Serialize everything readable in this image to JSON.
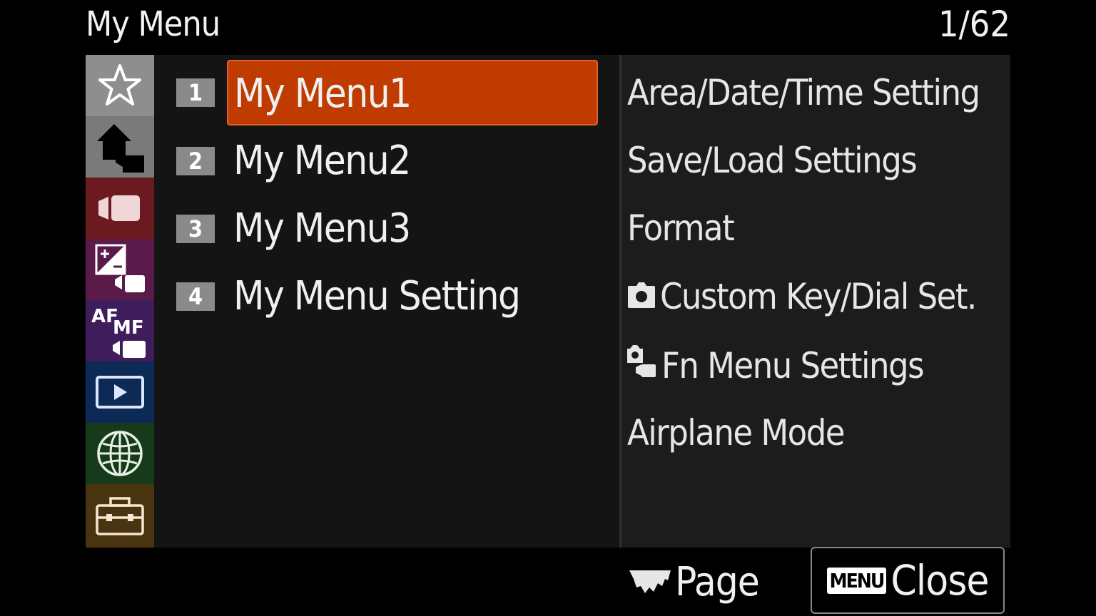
{
  "header": {
    "title": "My Menu",
    "page_indicator": "1/62"
  },
  "tabs": [
    {
      "icon": "star-icon",
      "color": "#8e8e8e"
    },
    {
      "icon": "home-icon",
      "color": "#7a7a7a"
    },
    {
      "icon": "movie-camera-icon",
      "color": "#6b1a1f"
    },
    {
      "icon": "exposure-icon",
      "color": "#5a1b4a"
    },
    {
      "icon": "af-mf-icon",
      "label_af": "AF",
      "label_mf": "MF",
      "color": "#3f1d5c"
    },
    {
      "icon": "playback-icon",
      "color": "#0d2a57"
    },
    {
      "icon": "globe-icon",
      "color": "#173a1a"
    },
    {
      "icon": "toolbox-icon",
      "color": "#4a3410"
    }
  ],
  "menus": [
    {
      "num": "1",
      "label": "My Menu1",
      "selected": true
    },
    {
      "num": "2",
      "label": "My Menu2"
    },
    {
      "num": "3",
      "label": "My Menu3"
    },
    {
      "num": "4",
      "label": "My Menu Setting"
    }
  ],
  "submenu": [
    {
      "label": "Area/Date/Time Setting"
    },
    {
      "label": "Save/Load Settings"
    },
    {
      "label": "Format"
    },
    {
      "label": "Custom Key/Dial Set.",
      "icon": "camera-icon"
    },
    {
      "label": "Fn Menu Settings",
      "icon": "still-movie-icon"
    },
    {
      "label": "Airplane Mode"
    }
  ],
  "footer": {
    "page_label": "Page",
    "menu_key": "MENU",
    "close_label": "Close"
  },
  "colors": {
    "accent": "#c03b00",
    "panel": "#141414",
    "panel_right": "#1c1c1c"
  }
}
